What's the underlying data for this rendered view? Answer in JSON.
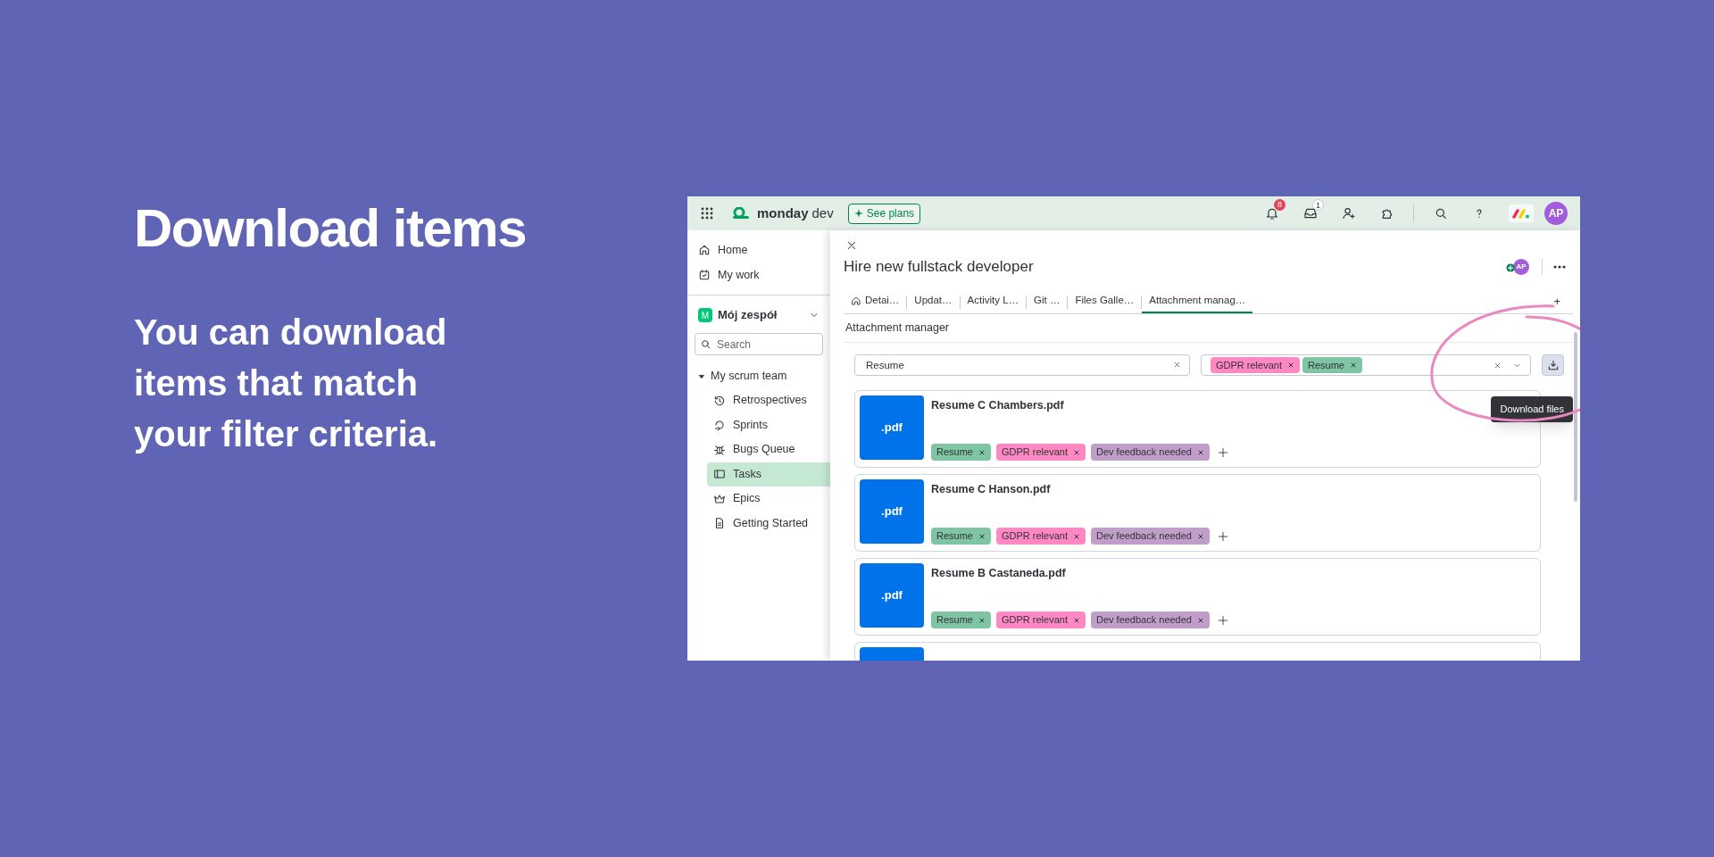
{
  "promo": {
    "headline": "Download items",
    "body": "You can download items that match your filter criteria."
  },
  "app": {
    "top_bar": {
      "logo_text": "monday",
      "logo_suffix": "dev",
      "see_plans": "See plans",
      "notifications_badge": "8",
      "inbox_badge": "1",
      "avatar": "AP"
    },
    "sidebar": {
      "nav": [
        {
          "label": "Home",
          "kind": "home"
        },
        {
          "label": "My work",
          "kind": "calendar"
        }
      ],
      "workspace": {
        "initial": "M",
        "name": "Mój zespół"
      },
      "search": {
        "placeholder": "Search"
      },
      "tree": [
        {
          "label": "My scrum team",
          "expanded": true,
          "children": [
            {
              "label": "Retrospectives",
              "kind": "history",
              "selected": false
            },
            {
              "label": "Sprints",
              "kind": "sprint",
              "selected": false
            },
            {
              "label": "Bugs Queue",
              "kind": "bug",
              "selected": false
            },
            {
              "label": "Tasks",
              "kind": "board",
              "selected": true
            },
            {
              "label": "Epics",
              "kind": "crown",
              "selected": false
            },
            {
              "label": "Getting Started",
              "kind": "doc",
              "selected": false
            }
          ]
        }
      ]
    },
    "item_panel": {
      "title": "Hire new fullstack developer",
      "avatar": "AP",
      "tabs": [
        {
          "label": "Detai…",
          "selected": false,
          "kind": "home"
        },
        {
          "label": "Updat…",
          "selected": false
        },
        {
          "label": "Activity L…",
          "selected": false
        },
        {
          "label": "Git …",
          "selected": false
        },
        {
          "label": "Files Galle…",
          "selected": false
        },
        {
          "label": "Attachment manag…",
          "selected": true
        }
      ],
      "add_tab": "+",
      "section_title": "Attachment manager",
      "search": {
        "value": "Resume"
      },
      "tag_filter": [
        {
          "label": "GDPR relevant",
          "color": "#ff88c2"
        },
        {
          "label": "Resume",
          "color": "#7fc4a3"
        }
      ],
      "download_tooltip": "Download files",
      "files": [
        {
          "name": "Resume C Chambers.pdf",
          "extension": ".pdf",
          "tags": [
            {
              "label": "Resume",
              "color": "#7fc4a3"
            },
            {
              "label": "GDPR relevant",
              "color": "#ff88c2"
            },
            {
              "label": "Dev feedback needed",
              "color": "#c19dc9"
            }
          ]
        },
        {
          "name": "Resume C Hanson.pdf",
          "extension": ".pdf",
          "tags": [
            {
              "label": "Resume",
              "color": "#7fc4a3"
            },
            {
              "label": "GDPR relevant",
              "color": "#ff88c2"
            },
            {
              "label": "Dev feedback needed",
              "color": "#c19dc9"
            }
          ]
        },
        {
          "name": "Resume B Castaneda.pdf",
          "extension": ".pdf",
          "tags": [
            {
              "label": "Resume",
              "color": "#7fc4a3"
            },
            {
              "label": "GDPR relevant",
              "color": "#ff88c2"
            },
            {
              "label": "Dev feedback needed",
              "color": "#c19dc9"
            }
          ]
        }
      ]
    }
  }
}
